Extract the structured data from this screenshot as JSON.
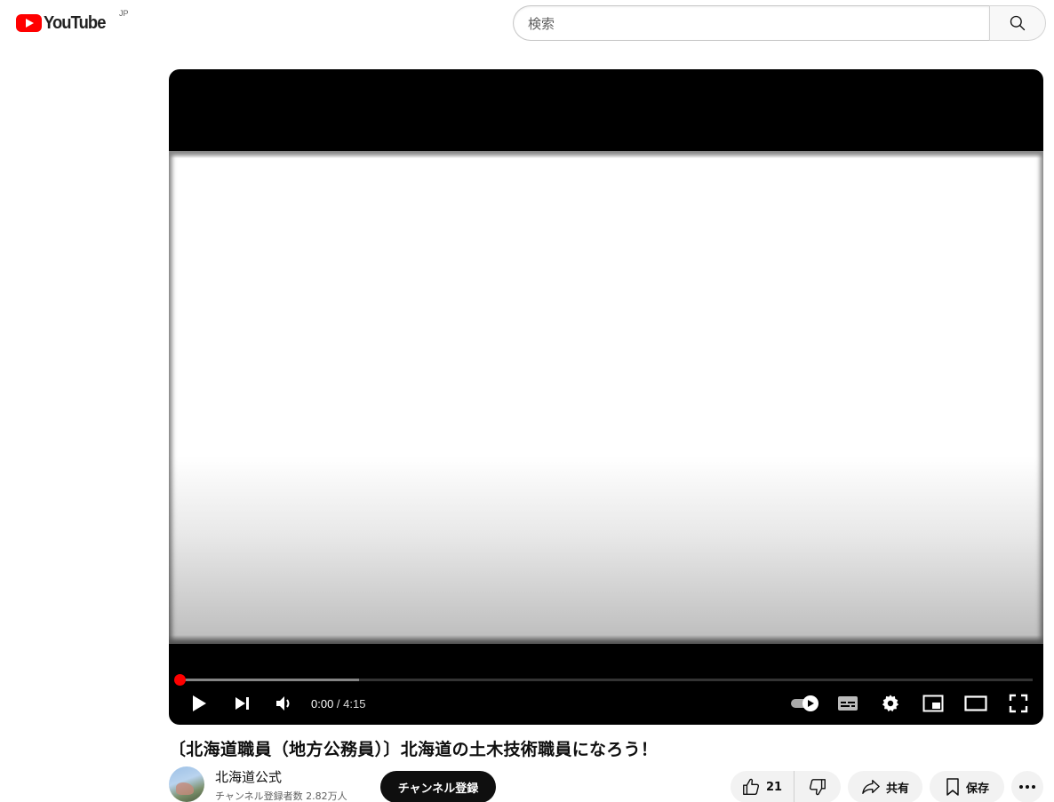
{
  "header": {
    "logo_text": "YouTube",
    "country_code": "JP",
    "search_placeholder": "検索",
    "search_icon": "search-icon"
  },
  "player": {
    "time_current": "0:00",
    "time_separator": " / ",
    "time_total": "4:15",
    "progress_played": 0.0,
    "progress_loaded": 0.21,
    "icons": [
      "play-icon",
      "next-icon",
      "volume-icon",
      "autoplay-toggle-icon",
      "subtitles-icon",
      "settings-icon",
      "miniplayer-icon",
      "theater-icon",
      "fullscreen-icon"
    ]
  },
  "video": {
    "title": "〔北海道職員（地方公務員）〕北海道の土木技術職員になろう！",
    "channel_name": "北海道公式",
    "subscribers": "チャンネル登録者数 2.82万人",
    "subscribe_label": "チャンネル登録"
  },
  "actions": {
    "like_count": "21",
    "share_label": "共有",
    "save_label": "保存"
  },
  "colors": {
    "brand_red": "#ff0000",
    "progress_red": "#f00",
    "subscribe_bg": "#0f0f0f",
    "pill_bg": "#f2f2f2"
  }
}
